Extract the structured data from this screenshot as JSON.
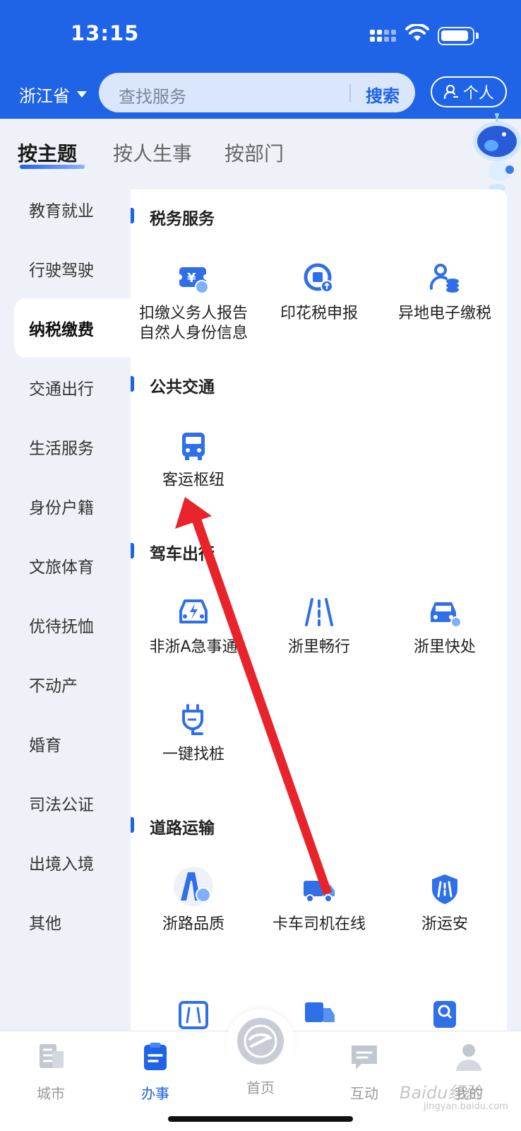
{
  "status": {
    "time": "13:15"
  },
  "header": {
    "province": "浙江省",
    "search_placeholder": "查找服务",
    "search_button": "搜索",
    "personal_button": "个人"
  },
  "tabs": [
    {
      "label": "按主题",
      "active": true
    },
    {
      "label": "按人生事",
      "active": false
    },
    {
      "label": "按部门",
      "active": false
    }
  ],
  "sidebar": {
    "items": [
      {
        "label": "教育就业"
      },
      {
        "label": "行驶驾驶"
      },
      {
        "label": "纳税缴费",
        "active": true
      },
      {
        "label": "交通出行"
      },
      {
        "label": "生活服务"
      },
      {
        "label": "身份户籍"
      },
      {
        "label": "文旅体育"
      },
      {
        "label": "优待抚恤"
      },
      {
        "label": "不动产"
      },
      {
        "label": "婚育"
      },
      {
        "label": "司法公证"
      },
      {
        "label": "出境入境"
      },
      {
        "label": "其他"
      }
    ]
  },
  "sections": [
    {
      "title": "税务服务",
      "services": [
        {
          "label_line1": "扣缴义务人报告",
          "label_line2": "自然人身份信息",
          "icon": "tax-ticket-icon"
        },
        {
          "label_line1": "印花税申报",
          "icon": "stamp-tax-icon"
        },
        {
          "label_line1": "异地电子缴税",
          "icon": "person-coins-icon"
        }
      ]
    },
    {
      "title": "公共交通",
      "services": [
        {
          "label_line1": "客运枢纽",
          "icon": "bus-icon"
        }
      ]
    },
    {
      "title": "驾车出行",
      "services": [
        {
          "label_line1": "非浙A急事通",
          "icon": "taxi-lightning-icon"
        },
        {
          "label_line1": "浙里畅行",
          "icon": "road-icon"
        },
        {
          "label_line1": "浙里快处",
          "icon": "car-accident-icon"
        },
        {
          "label_line1": "一键找桩",
          "icon": "charger-plug-icon"
        }
      ]
    },
    {
      "title": "道路运输",
      "services": [
        {
          "label_line1": "浙路品质",
          "icon": "road-quality-icon"
        },
        {
          "label_line1": "卡车司机在线",
          "icon": "truck-icon"
        },
        {
          "label_line1": "浙运安",
          "icon": "shield-road-icon"
        }
      ]
    }
  ],
  "bottom_nav": [
    {
      "label": "城市",
      "icon": "city-icon"
    },
    {
      "label": "办事",
      "icon": "clipboard-icon",
      "active": true
    },
    {
      "label": "首页",
      "icon": "home-logo-icon"
    },
    {
      "label": "互动",
      "icon": "chat-icon"
    },
    {
      "label": "我的",
      "icon": "user-icon"
    }
  ],
  "watermark": {
    "text": "Baidu经验",
    "sub": "jingyan.baidu.com"
  },
  "colors": {
    "brand": "#1f63e6",
    "annotation_arrow": "#e8242a"
  }
}
